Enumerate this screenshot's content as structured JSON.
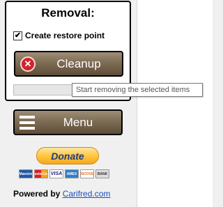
{
  "removal": {
    "title": "Removal:",
    "restore_point": {
      "label": "Create restore point",
      "checked": true
    },
    "cleanup_button": {
      "label": "Cleanup",
      "icon": "red-x-icon"
    },
    "progress": {
      "fraction": 0
    },
    "tooltip": "Start removing the selected items"
  },
  "menu_button": {
    "label": "Menu",
    "icon": "hamburger-icon"
  },
  "donate": {
    "label": "Donate",
    "cards": [
      "Maestro",
      "MasterCard",
      "VISA",
      "AMEX",
      "DISCOVER",
      "BANK"
    ]
  },
  "footer": {
    "powered_by": "Powered by",
    "link_text": "Carifred.com"
  },
  "colors": {
    "button_bg": "#7e6c55",
    "accent_red": "#d3232b",
    "link_blue": "#1a4fb5",
    "donate_gold": "#ffc339"
  }
}
